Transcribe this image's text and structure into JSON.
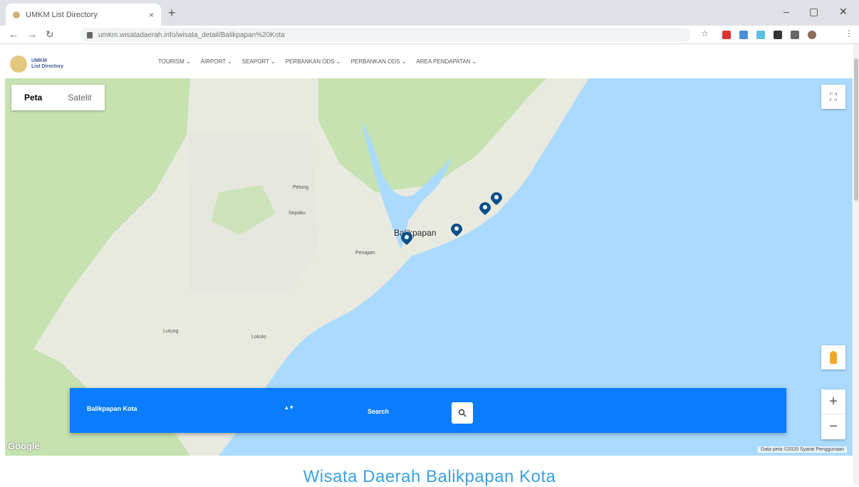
{
  "browser": {
    "tab_title": "UMKM List Directory",
    "tab_close": "×",
    "new_tab": "+",
    "url": "umkm.wisatadaerah.info/wisata_detail/Balikpapan%20Kota",
    "min": "–",
    "max": "▢",
    "close": "✕"
  },
  "site": {
    "logo_line1": "UMKM",
    "logo_line2": "List Directory",
    "menu": [
      "TOURISM ⌄",
      "AIRPORT ⌄",
      "SEAPORT ⌄",
      "PERBANKAN ODS ⌄",
      "PERBANKAN ODS ⌄",
      "AREA PENDAPATAN ⌄"
    ]
  },
  "map": {
    "toggle_map": "Peta",
    "toggle_sat": "Satelit",
    "city_label": "Balikpapan",
    "towns": [
      "Penajam",
      "Petung",
      "Sepaku",
      "Lokolo",
      "Lutung"
    ],
    "google": "Google",
    "attribution": "Data peta ©2020   Syarat Penggunaan",
    "zoom_in": "+",
    "zoom_out": "−",
    "fullscreen": "⛶"
  },
  "search": {
    "selected": "Balikpapan Kota",
    "caret": "▴ ▾",
    "label": "Search"
  },
  "heading": "Wisata Daerah Balikpapan Kota",
  "colors": {
    "accent": "#0a7cff",
    "water": "#aadaff",
    "land": "#e8eadf",
    "forest": "#c5e2b0"
  }
}
